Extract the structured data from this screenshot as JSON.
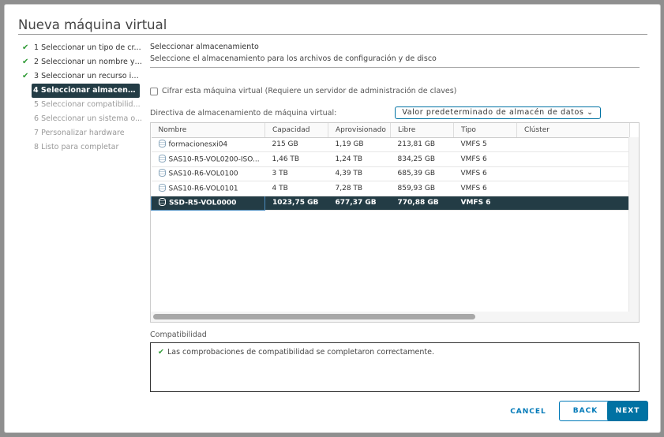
{
  "dialog": {
    "title": "Nueva máquina virtual"
  },
  "steps": [
    {
      "label": "1 Seleccionar un tipo de cr...",
      "state": "done"
    },
    {
      "label": "2 Seleccionar un nombre y ...",
      "state": "done"
    },
    {
      "label": "3 Seleccionar un recurso in...",
      "state": "done"
    },
    {
      "label": "4 Seleccionar almacenamie...",
      "state": "active"
    },
    {
      "label": "5 Seleccionar compatibilid...",
      "state": "pending"
    },
    {
      "label": "6 Seleccionar un sistema o...",
      "state": "pending"
    },
    {
      "label": "7 Personalizar hardware",
      "state": "pending"
    },
    {
      "label": "8 Listo para completar",
      "state": "pending"
    }
  ],
  "section": {
    "title": "Seleccionar almacenamiento",
    "subtitle": "Seleccione el almacenamiento para los archivos de configuración y de disco"
  },
  "encrypt": {
    "label": "Cifrar esta máquina virtual (Requiere un servidor de administración de claves)",
    "checked": false
  },
  "policy": {
    "label": "Directiva de almacenamiento de máquina virtual:",
    "value": "Valor predeterminado de almacén de datos"
  },
  "table": {
    "columns": [
      "Nombre",
      "Capacidad",
      "Aprovisionado",
      "Libre",
      "Tipo",
      "Clúster"
    ],
    "rows": [
      {
        "name": "formacionesxi04",
        "capacity": "215 GB",
        "provisioned": "1,19 GB",
        "free": "213,81 GB",
        "type": "VMFS 5",
        "cluster": "",
        "selected": false
      },
      {
        "name": "SAS10-R5-VOL0200-ISO...",
        "capacity": "1,46 TB",
        "provisioned": "1,24 TB",
        "free": "834,25 GB",
        "type": "VMFS 6",
        "cluster": "",
        "selected": false
      },
      {
        "name": "SAS10-R6-VOL0100",
        "capacity": "3 TB",
        "provisioned": "4,39 TB",
        "free": "685,39 GB",
        "type": "VMFS 6",
        "cluster": "",
        "selected": false
      },
      {
        "name": "SAS10-R6-VOL0101",
        "capacity": "4 TB",
        "provisioned": "7,28 TB",
        "free": "859,93 GB",
        "type": "VMFS 6",
        "cluster": "",
        "selected": false
      },
      {
        "name": "SSD-R5-VOL0000",
        "capacity": "1023,75 GB",
        "provisioned": "677,37 GB",
        "free": "770,88 GB",
        "type": "VMFS 6",
        "cluster": "",
        "selected": true
      }
    ]
  },
  "compatibility": {
    "label": "Compatibilidad",
    "message": "Las comprobaciones de compatibilidad se completaron correctamente."
  },
  "buttons": {
    "cancel": "CANCEL",
    "back": "BACK",
    "next": "NEXT"
  },
  "colors": {
    "accent": "#0072a3",
    "selected_row": "#233c45",
    "success": "#2f9a35"
  }
}
